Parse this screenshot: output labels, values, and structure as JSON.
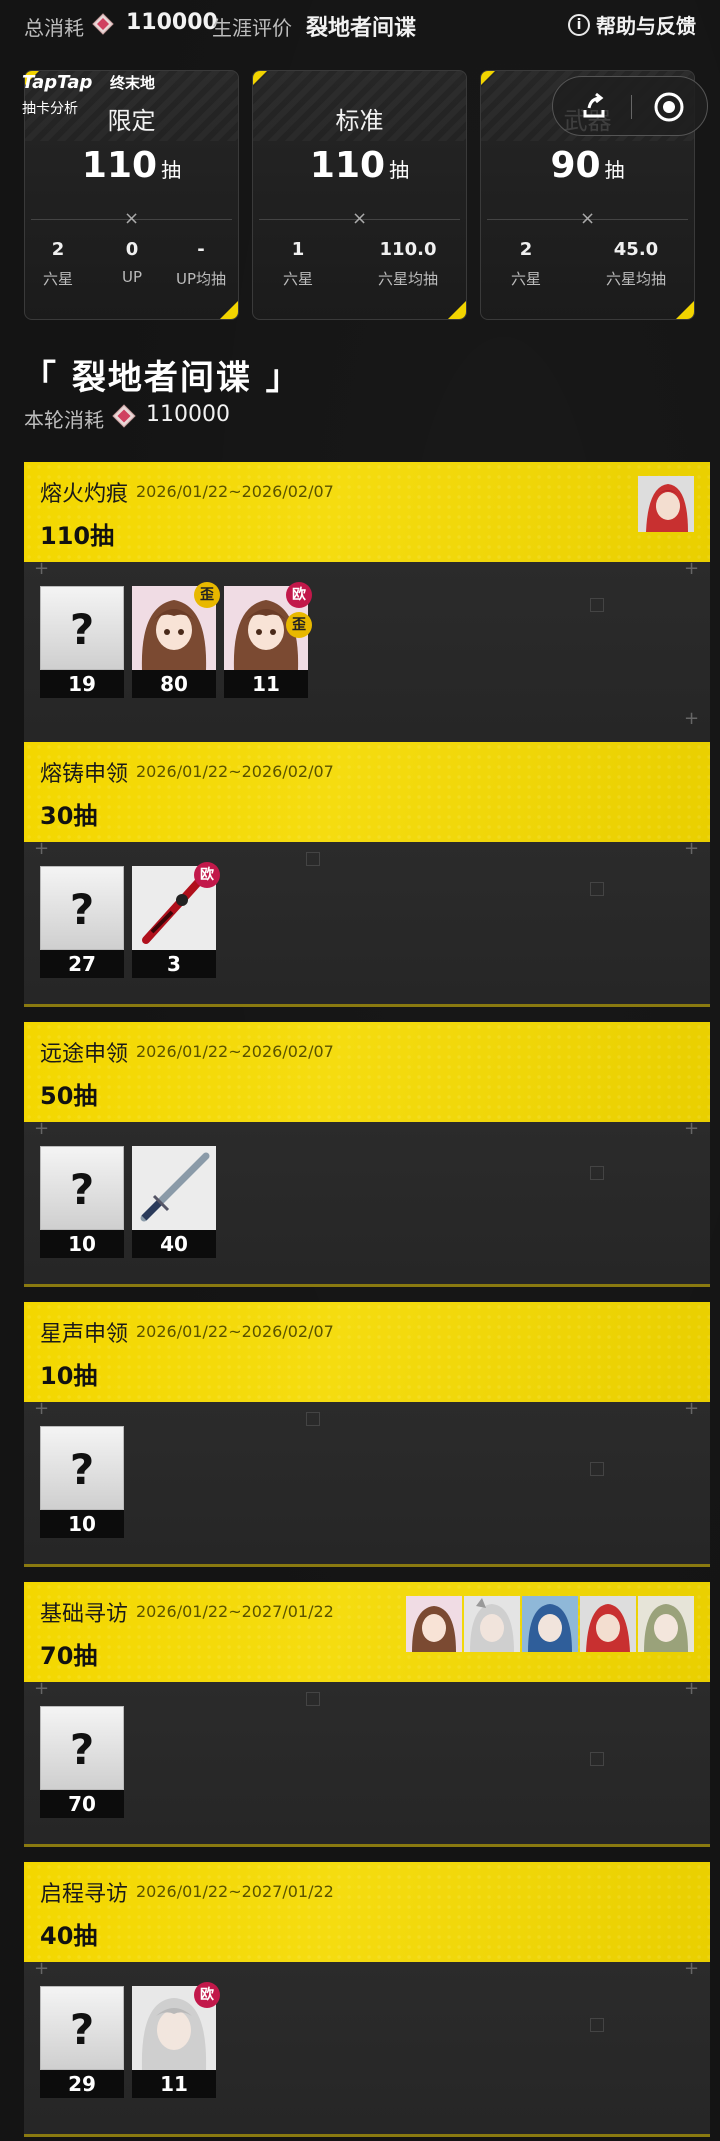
{
  "topbar": {
    "total_label": "总消耗",
    "total_value": "110000",
    "eval_label": "生涯评价",
    "eval_value": "裂地者间谍",
    "help_label": "帮助与反馈"
  },
  "brand": {
    "taptap": "TapTap",
    "game": "终末地",
    "subtitle": "抽卡分析"
  },
  "pools": [
    {
      "name": "限定",
      "count": "110",
      "unit": "抽",
      "x": "×",
      "stats": [
        {
          "v": "2",
          "k": "六星"
        },
        {
          "v": "0",
          "k": "UP"
        },
        {
          "v": "-",
          "k": "UP均抽"
        }
      ]
    },
    {
      "name": "标准",
      "count": "110",
      "unit": "抽",
      "x": "×",
      "stats": [
        {
          "v": "1",
          "k": "六星"
        },
        {
          "v": "110.0",
          "k": "六星均抽"
        }
      ]
    },
    {
      "name": "武器",
      "count": "90",
      "unit": "抽",
      "x": "×",
      "stats": [
        {
          "v": "2",
          "k": "六星"
        },
        {
          "v": "45.0",
          "k": "六星均抽"
        }
      ]
    }
  ],
  "section": {
    "title": "「 裂地者间谍 」",
    "sub_label": "本轮消耗",
    "sub_value": "110000"
  },
  "banners": [
    {
      "name": "熔火灼痕",
      "date": "2026/01/22~2026/02/07",
      "count": "110抽",
      "tiles": [
        {
          "kind": "unknown",
          "num": "19"
        },
        {
          "kind": "char",
          "num": "80",
          "badges": [
            "歪"
          ]
        },
        {
          "kind": "char",
          "num": "11",
          "badges": [
            "欧",
            "歪"
          ]
        }
      ]
    },
    {
      "name": "熔铸申领",
      "date": "2026/01/22~2026/02/07",
      "count": "30抽",
      "tiles": [
        {
          "kind": "unknown",
          "num": "27"
        },
        {
          "kind": "weapon-red",
          "num": "3",
          "badges": [
            "欧"
          ]
        }
      ]
    },
    {
      "name": "远途申领",
      "date": "2026/01/22~2026/02/07",
      "count": "50抽",
      "tiles": [
        {
          "kind": "unknown",
          "num": "10"
        },
        {
          "kind": "weapon-sword",
          "num": "40",
          "badges": []
        }
      ]
    },
    {
      "name": "星声申领",
      "date": "2026/01/22~2026/02/07",
      "count": "10抽",
      "tiles": [
        {
          "kind": "unknown",
          "num": "10"
        }
      ]
    },
    {
      "name": "基础寻访",
      "date": "2026/01/22~2027/01/22",
      "count": "70抽",
      "tiles": [
        {
          "kind": "unknown",
          "num": "70"
        }
      ]
    },
    {
      "name": "启程寻访",
      "date": "2026/01/22~2027/01/22",
      "count": "40抽",
      "tiles": [
        {
          "kind": "unknown",
          "num": "29"
        },
        {
          "kind": "char-white",
          "num": "11",
          "badges": [
            "欧"
          ]
        }
      ]
    }
  ],
  "colors": {
    "accent": "#f3d700",
    "badge_red": "#c2184a",
    "badge_gold": "#e8b800",
    "background": "#141414"
  },
  "icons": {
    "gem": "gem-icon",
    "info": "info-icon",
    "share": "share-icon",
    "record": "record-icon"
  }
}
